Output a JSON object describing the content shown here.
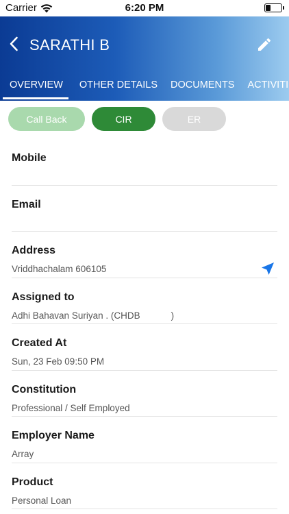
{
  "status_bar": {
    "carrier": "Carrier",
    "time": "6:20 PM",
    "battery_level": 0.35
  },
  "header": {
    "title": "SARATHI B",
    "back_icon": "chevron-left-icon",
    "edit_icon": "pencil-icon"
  },
  "tabs": [
    {
      "label": "OVERVIEW",
      "active": true
    },
    {
      "label": "OTHER DETAILS",
      "active": false
    },
    {
      "label": "DOCUMENTS",
      "active": false
    },
    {
      "label": "ACTIVITIES",
      "active": false
    }
  ],
  "status_pills": {
    "call_back": "Call Back",
    "cir": "CIR",
    "er": "ER"
  },
  "fields": {
    "mobile": {
      "label": "Mobile",
      "value": ""
    },
    "email": {
      "label": "Email",
      "value": ""
    },
    "address": {
      "label": "Address",
      "value": "Vriddhachalam 606105"
    },
    "assigned_to": {
      "label": "Assigned to",
      "value": "Adhi Bahavan Suriyan . (CHDB            )"
    },
    "created_at": {
      "label": "Created At",
      "value": "Sun, 23 Feb 09:50 PM"
    },
    "constitution": {
      "label": "Constitution",
      "value": "Professional / Self Employed"
    },
    "employer_name": {
      "label": "Employer Name",
      "value": "Array"
    },
    "product": {
      "label": "Product",
      "value": "Personal Loan"
    }
  },
  "colors": {
    "header_gradient_start": "#0b3b94",
    "header_gradient_end": "#9ccbef",
    "cir_active": "#2e8a37",
    "call_back_pill": "#a9d9ad",
    "er_pill": "#d9d9d9",
    "navigate_icon": "#1976e8"
  }
}
